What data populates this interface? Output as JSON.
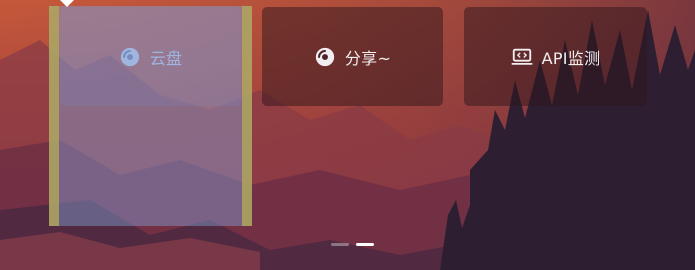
{
  "tiles": [
    {
      "label": "云盘",
      "icon": "disc-icon"
    },
    {
      "label": "分享~",
      "icon": "disc-icon"
    },
    {
      "label": "API监测",
      "icon": "monitor-code-icon"
    }
  ],
  "carousel": {
    "slide_count": 2,
    "active_index": 1
  },
  "colors": {
    "sky_top": "#c65a3a",
    "sky_bottom": "#8e3a44",
    "forest": "#2d1f31",
    "tile_bg": "#3a1d24",
    "highlight_fill": "#86a2d6",
    "highlight_border": "#afa55a"
  }
}
